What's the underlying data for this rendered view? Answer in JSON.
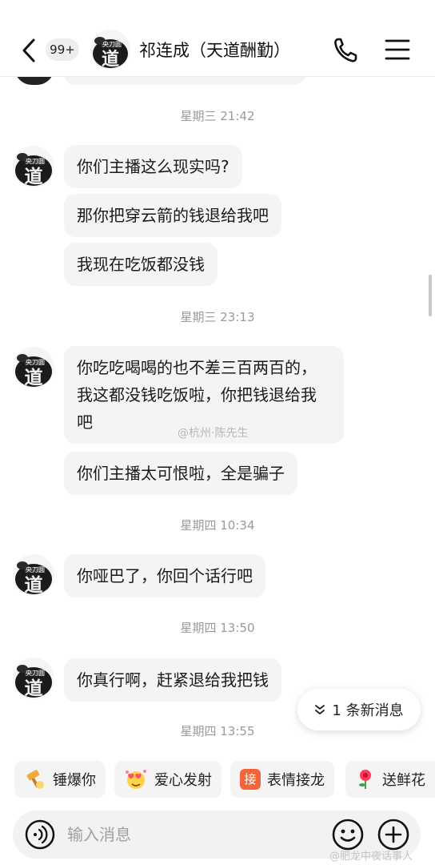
{
  "header": {
    "unread_badge": "99+",
    "contact_name": "祁连成（天道酬勤）",
    "avatar_text": "道",
    "avatar_caption": "央刀圆"
  },
  "messages": [
    {
      "type": "timestamp",
      "text": "星期三 21:42"
    },
    {
      "type": "text",
      "text": "你们主播这么现实吗?"
    },
    {
      "type": "text",
      "text": "那你把穿云箭的钱退给我吧"
    },
    {
      "type": "text",
      "text": "我现在吃饭都没钱"
    },
    {
      "type": "timestamp",
      "text": "星期三 23:13"
    },
    {
      "type": "text",
      "text": "你吃吃喝喝的也不差三百两百的，我这都没钱吃饭啦，你把钱退给我吧"
    },
    {
      "type": "text",
      "text": "你们主播太可恨啦，全是骗子"
    },
    {
      "type": "timestamp",
      "text": "星期四 10:34"
    },
    {
      "type": "text",
      "text": "你哑巴了，你回个话行吧"
    },
    {
      "type": "timestamp",
      "text": "星期四 13:50"
    },
    {
      "type": "text",
      "text": "你真行啊，赶紧退给我把钱"
    },
    {
      "type": "timestamp",
      "text": "星期四 13:55"
    }
  ],
  "watermark": "@杭州·陈先生",
  "new_message_pill": "1 条新消息",
  "quick_actions": [
    {
      "label": "锤爆你",
      "icon": "hammer-icon"
    },
    {
      "label": "爱心发射",
      "icon": "heart-face-icon"
    },
    {
      "label": "表情接龙",
      "icon": "emoji-relay-icon",
      "glyph": "接"
    },
    {
      "label": "送鲜花",
      "icon": "flower-icon"
    }
  ],
  "input": {
    "placeholder": "输入消息"
  },
  "bottom_watermark": "@肥龙中夜话事人",
  "colors": {
    "bubble_bg": "#f4f4f4",
    "timestamp": "#9a9a9a",
    "relay_accent": "#f2643a"
  }
}
